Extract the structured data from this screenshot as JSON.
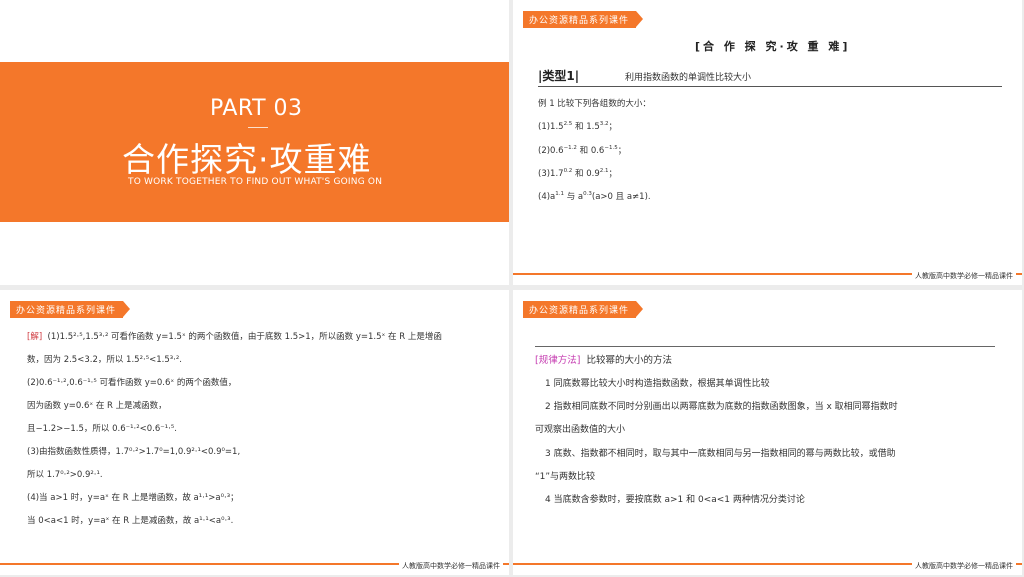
{
  "slide1": {
    "part": "PART 03",
    "title": "合作探究·攻重难",
    "subtitle_en": "TO WORK TOGETHER TO FIND OUT WHAT'S GOING ON"
  },
  "common": {
    "tag": "办公资源精品系列课件",
    "footer": "人教版高中数学必修一精品课件"
  },
  "slide2": {
    "heading": "[合 作 探 究·攻 重 难]",
    "type_label": "|类型1|",
    "type_desc": "利用指数函数的单调性比较大小",
    "example_intro": "例 1  比较下列各组数的大小：",
    "items": [
      {
        "prefix": "(1)1.5",
        "e1": "2.5",
        "mid": "和 1.5",
        "e2": "3.2",
        "suffix": "；"
      },
      {
        "prefix": "(2)0.6",
        "e1": "−1.2",
        "mid": "和 0.6",
        "e2": "−1.5",
        "suffix": "；"
      },
      {
        "prefix": "(3)1.7",
        "e1": "0.2",
        "mid": "和 0.9",
        "e2": "2.1",
        "suffix": "；"
      },
      {
        "prefix": "(4)a",
        "e1": "1.1",
        "mid": "与  a",
        "e2": "0.3",
        "suffix": "(a>0 且 a≠1)."
      }
    ]
  },
  "slide3": {
    "label": "[解]",
    "lines": [
      "(1)1.5²·⁵,1.5³·² 可看作函数 y=1.5ˣ 的两个函数值，由于底数 1.5>1，所以函数 y=1.5ˣ 在 R 上是增函",
      "数，因为 2.5<3.2，所以 1.5²·⁵<1.5³·².",
      "(2)0.6⁻¹·²,0.6⁻¹·⁵ 可看作函数 y=0.6ˣ 的两个函数值，",
      "因为函数 y=0.6ˣ 在 R 上是减函数，",
      "且−1.2>−1.5，所以 0.6⁻¹·²<0.6⁻¹·⁵.",
      "(3)由指数函数性质得，1.7⁰·²>1.7⁰=1,0.9²·¹<0.9⁰=1,",
      "所以 1.7⁰·²>0.9²·¹.",
      "(4)当 a>1 时，y=aˣ 在 R 上是增函数，故 a¹·¹>a⁰·³；",
      "当 0<a<1 时，y=aˣ 在 R 上是减函数，故 a¹·¹<a⁰·³."
    ]
  },
  "slide4": {
    "title_bracket": "[规律方法]",
    "title_text": "比较幂的大小的方法",
    "items": [
      "1    同底数幂比较大小时构造指数函数，根据其单调性比较",
      "2    指数相同底数不同时分别画出以两幂底数为底数的指数函数图象，当 x 取相同幂指数时",
      "可观察出函数值的大小",
      "3    底数、指数都不相同时，取与其中一底数相同与另一指数相同的幂与两数比较，或借助",
      "“1”与两数比较",
      "4    当底数含参数时，要按底数 a>1 和 0<a<1 两种情况分类讨论"
    ]
  },
  "colors": {
    "accent": "#f4772a",
    "label_red": "#d0393f",
    "bracket_magenta": "#c53bb0"
  }
}
